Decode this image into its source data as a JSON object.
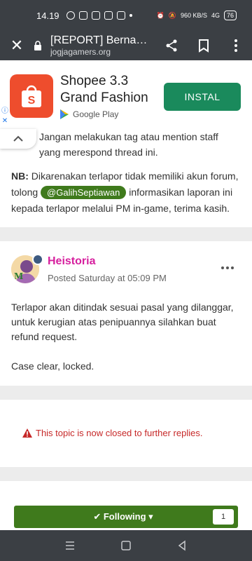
{
  "status_bar": {
    "time": "14.19",
    "net_speed": "960 KB/S",
    "network": "4G",
    "battery": "76"
  },
  "toolbar": {
    "title": "[REPORT] Bernan…",
    "url": "jogjagamers.org"
  },
  "ad": {
    "title": "Shopee 3.3 Grand Fashion",
    "store": "Google Play",
    "install_label": "INSTAL"
  },
  "thread": {
    "quote_tail": "Jangan melakukan tag atau mention staff yang merespond thread ini.",
    "nb_label": "NB:",
    "nb_text_1": " Dikarenakan terlapor tidak memiliki akun forum, tolong ",
    "mention": "@GalihSeptiawan",
    "nb_text_2": " informasikan laporan ini kepada terlapor melalui PM in-game, terima kasih."
  },
  "post": {
    "author": "Heistoria",
    "posted": "Posted Saturday at 05:09 PM",
    "paragraphs": [
      "Terlapor akan ditindak sesuai pasal yang dilanggar, untuk kerugian atas penipuannya silahkan buat refund request.",
      "Case clear, locked."
    ]
  },
  "closed_notice": "This topic is now closed to further replies.",
  "follow": {
    "label": "Following",
    "count": "1"
  },
  "colors": {
    "accent_green": "#3f7a1c",
    "author_pink": "#d61f9e",
    "closed_red": "#c62828",
    "install_green": "#1a8a5c"
  }
}
